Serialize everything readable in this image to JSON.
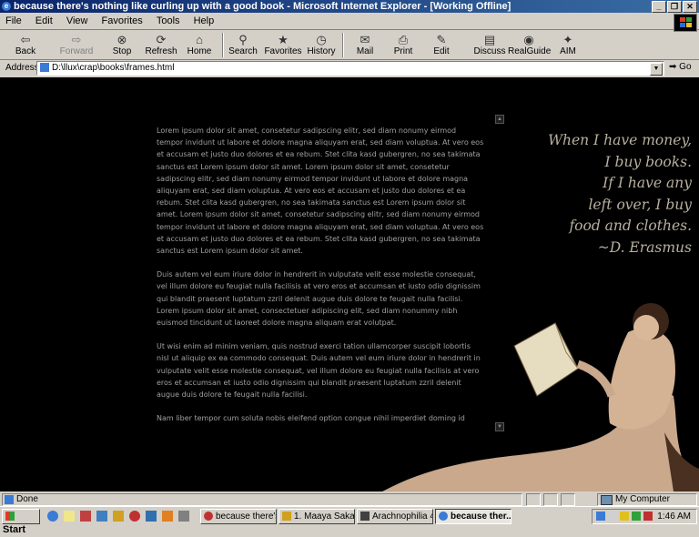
{
  "window": {
    "title": "because there's nothing like curling up with a good book - Microsoft Internet Explorer - [Working Offline]",
    "buttons": [
      "_",
      "❐",
      "✕"
    ]
  },
  "menu": [
    "File",
    "Edit",
    "View",
    "Favorites",
    "Tools",
    "Help"
  ],
  "toolbar": {
    "back": "Back",
    "forward": "Forward",
    "stop": "Stop",
    "refresh": "Refresh",
    "home": "Home",
    "search": "Search",
    "favorites": "Favorites",
    "history": "History",
    "mail": "Mail",
    "print": "Print",
    "edit": "Edit",
    "discuss": "Discuss",
    "realguide": "RealGuide",
    "aim": "AIM"
  },
  "address": {
    "label": "Address",
    "url": "D:\\llux\\crap\\books\\frames.html",
    "go": "Go"
  },
  "page": {
    "paragraphs": [
      "Lorem ipsum dolor sit amet, consetetur sadipscing elitr, sed diam nonumy eirmod tempor invidunt ut labore et dolore magna aliquyam erat, sed diam voluptua. At vero eos et accusam et justo duo dolores et ea rebum. Stet clita kasd gubergren, no sea takimata sanctus est Lorem ipsum dolor sit amet. Lorem ipsum dolor sit amet, consetetur sadipscing elitr, sed diam nonumy eirmod tempor invidunt ut labore et dolore magna aliquyam erat, sed diam voluptua. At vero eos et accusam et justo duo dolores et ea rebum. Stet clita kasd gubergren, no sea takimata sanctus est Lorem ipsum dolor sit amet. Lorem ipsum dolor sit amet, consetetur sadipscing elitr, sed diam nonumy eirmod tempor invidunt ut labore et dolore magna aliquyam erat, sed diam voluptua. At vero eos et accusam et justo duo dolores et ea rebum. Stet clita kasd gubergren, no sea takimata sanctus est Lorem ipsum dolor sit amet.",
      "Duis autem vel eum iriure dolor in hendrerit in vulputate velit esse molestie consequat, vel illum dolore eu feugiat nulla facilisis at vero eros et accumsan et iusto odio dignissim qui blandit praesent luptatum zzril delenit augue duis dolore te feugait nulla facilisi. Lorem ipsum dolor sit amet, consectetuer adipiscing elit, sed diam nonummy nibh euismod tincidunt ut laoreet dolore magna aliquam erat volutpat.",
      "Ut wisi enim ad minim veniam, quis nostrud exerci tation ullamcorper suscipit lobortis nisl ut aliquip ex ea commodo consequat. Duis autem vel eum iriure dolor in hendrerit in vulputate velit esse molestie consequat, vel illum dolore eu feugiat nulla facilisis at vero eros et accumsan et iusto odio dignissim qui blandit praesent luptatum zzril delenit augue duis dolore te feugait nulla facilisi.",
      "Nam liber tempor cum soluta nobis eleifend option congue nihil imperdiet doming id"
    ],
    "quote": [
      "When I have money,",
      "I buy books.",
      "If I have any",
      "left over, I buy",
      "food and clothes.",
      "~D. Erasmus"
    ]
  },
  "status": {
    "text": "Done",
    "zone": "My Computer"
  },
  "taskbar": {
    "start": "Start",
    "tasks": [
      "because there's ...",
      "1. Maaya Saka...",
      "Arachnophilia 4....",
      "because ther..."
    ],
    "clock": "1:46 AM"
  },
  "colors": {
    "title_gradient_start": "#0a246a",
    "title_gradient_end": "#3a6ea5",
    "chrome": "#d4d0c8",
    "page_background": "#000000",
    "body_text": "#a0a0a0",
    "quote_text": "#b8b0a0"
  }
}
